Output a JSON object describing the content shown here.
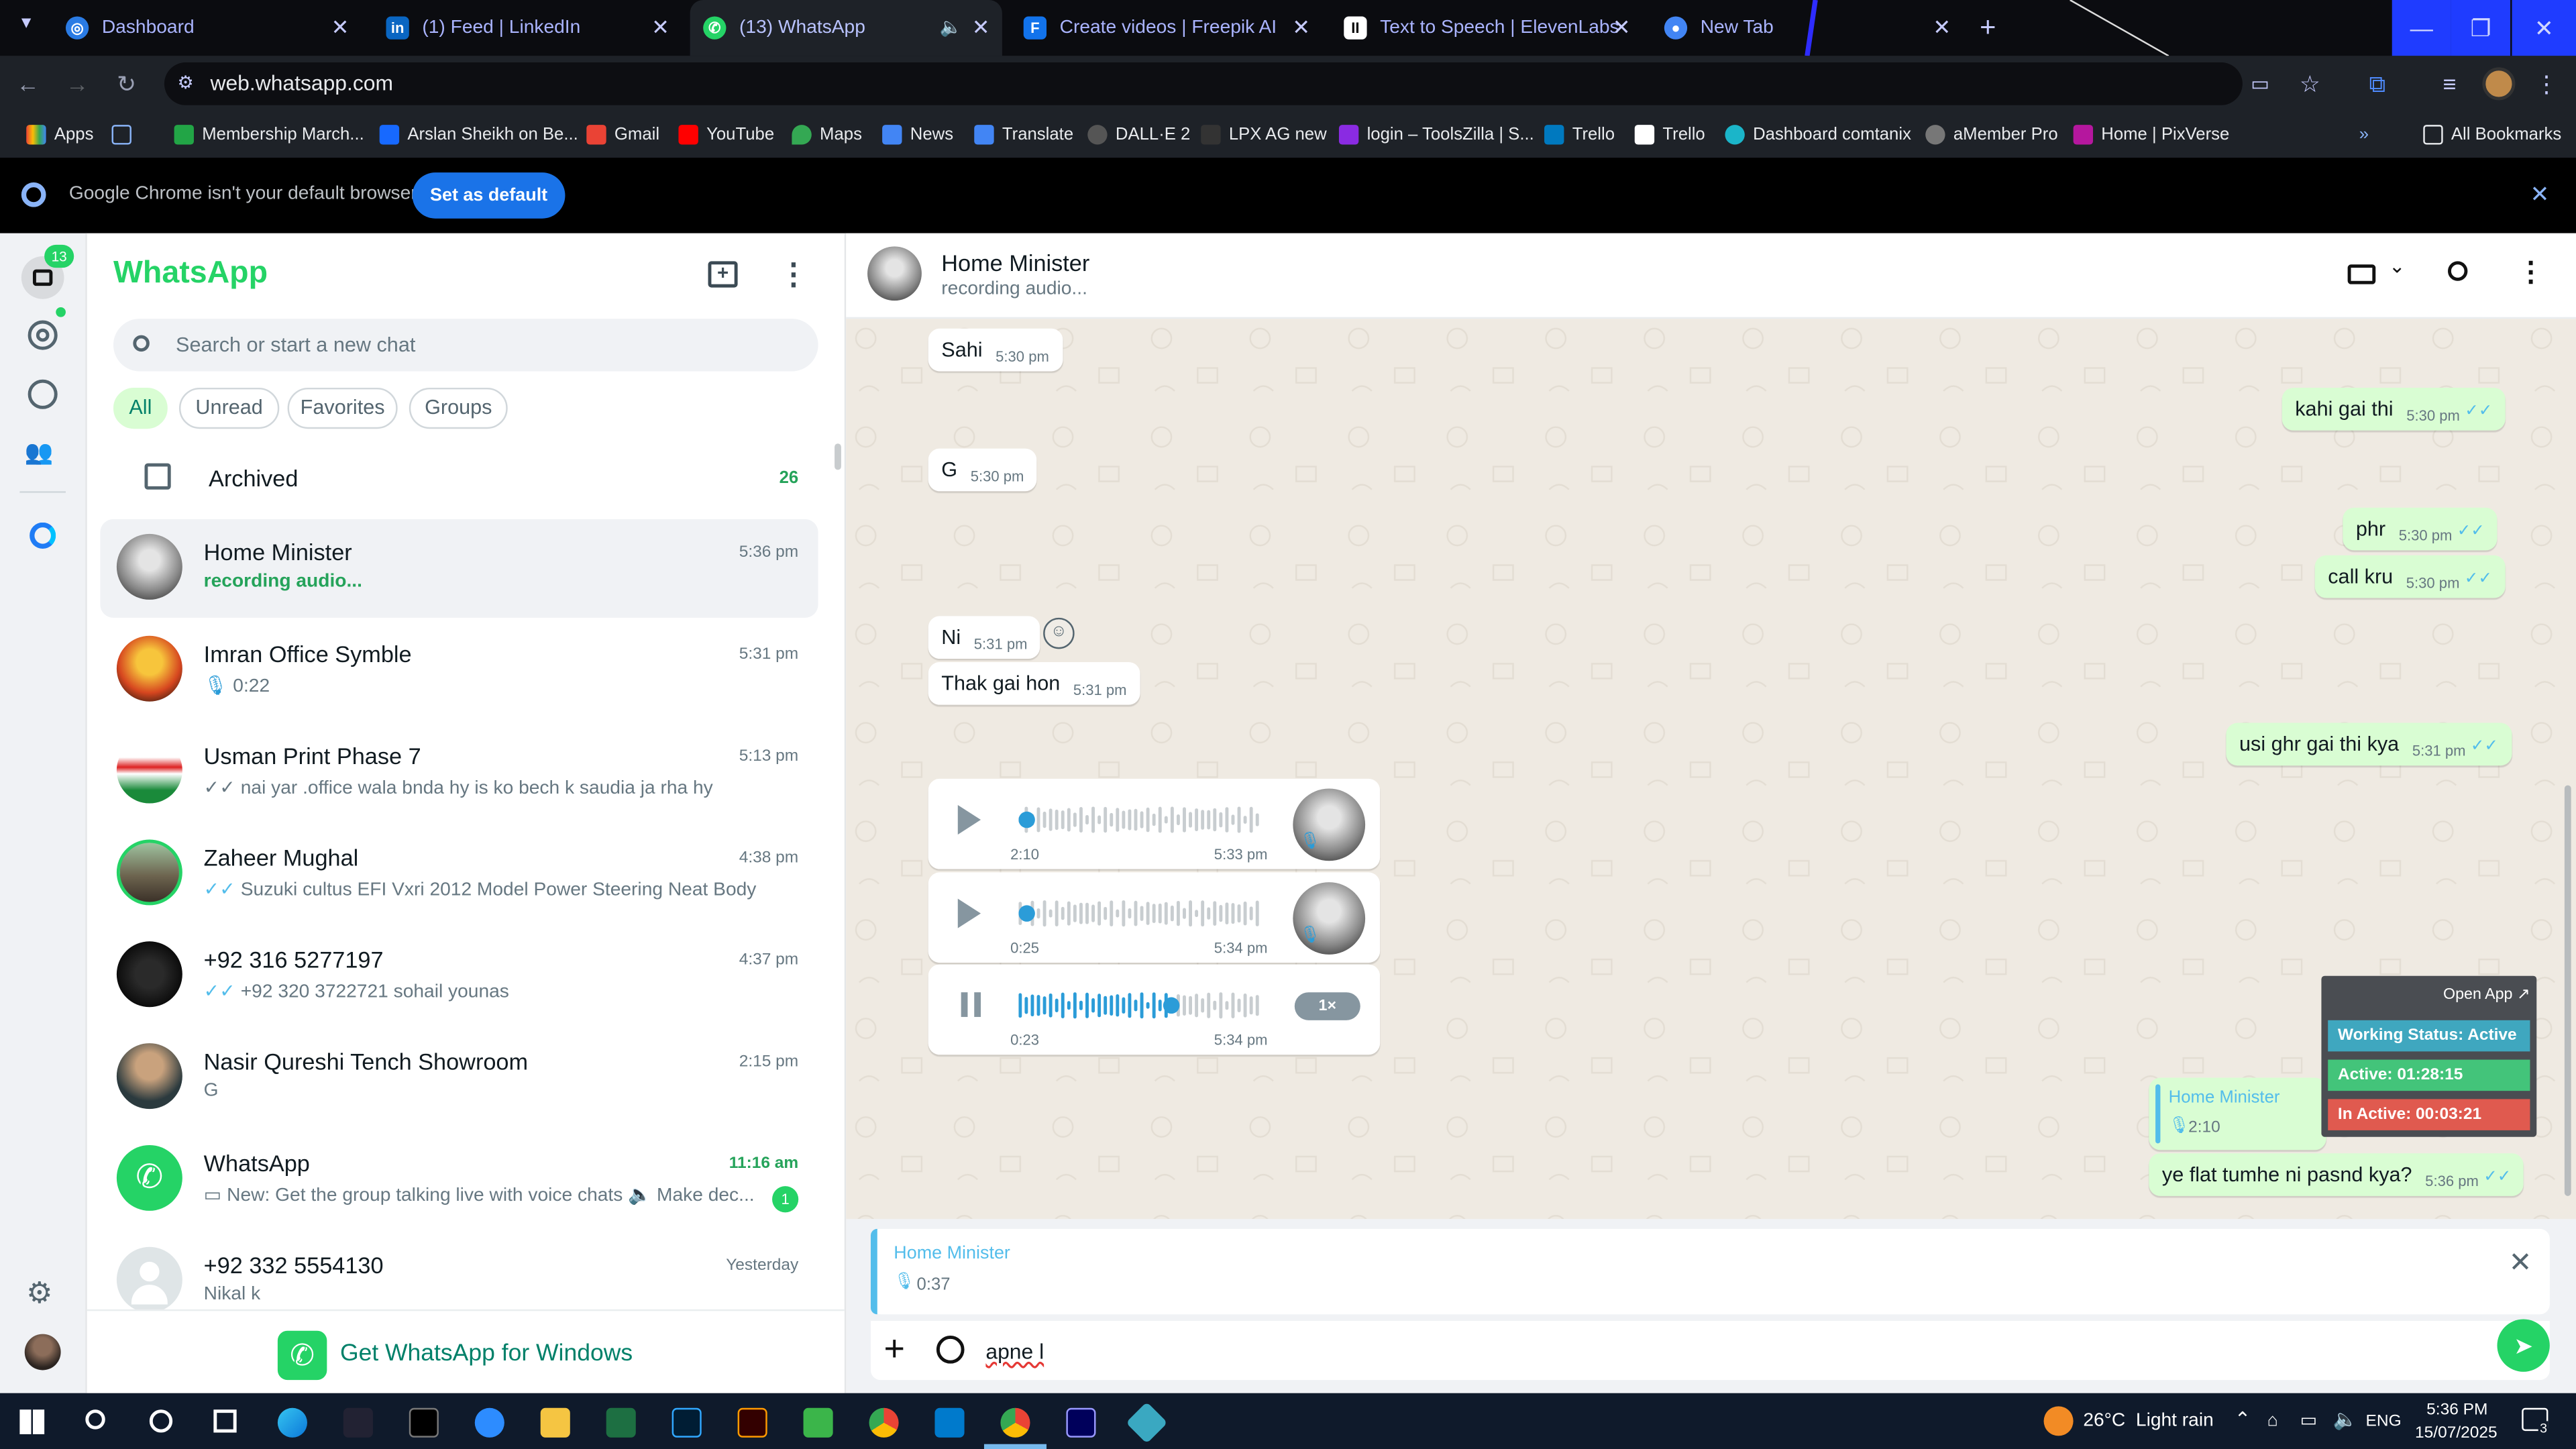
{
  "browser": {
    "tabs": [
      {
        "title": "Dashboard",
        "icon": "globe-icon",
        "color": "#2a7be4"
      },
      {
        "title": "(1) Feed | LinkedIn",
        "icon": "linkedin-icon",
        "color": "#0a66c2"
      },
      {
        "title": "(13) WhatsApp",
        "icon": "whatsapp-icon",
        "color": "#25d366"
      },
      {
        "title": "Create videos | Freepik AI",
        "icon": "freepik-icon",
        "color": "#1273eb"
      },
      {
        "title": "Text to Speech | ElevenLabs",
        "icon": "elevenlabs-icon",
        "color": "#ffffff"
      },
      {
        "title": "New Tab",
        "icon": "chrome-icon",
        "color": "#4285f4"
      }
    ],
    "url": "web.whatsapp.com",
    "bookmarks": [
      "Apps",
      "Membership March...",
      "Arslan Sheikh on Be...",
      "Gmail",
      "YouTube",
      "Maps",
      "News",
      "Translate",
      "DALL·E 2",
      "LPX AG new",
      "login – ToolsZilla | S...",
      "Trello",
      "Trello",
      "Dashboard comtanix",
      "aMember Pro",
      "Home | PixVerse"
    ],
    "all_bookmarks": "All Bookmarks",
    "infobar": {
      "text": "Google Chrome isn't your default browser",
      "button": "Set as default"
    }
  },
  "rail": {
    "chats_badge": "13"
  },
  "sidebar": {
    "title": "WhatsApp",
    "search_placeholder": "Search or start a new chat",
    "filters": [
      "All",
      "Unread",
      "Favorites",
      "Groups"
    ],
    "archived": {
      "label": "Archived",
      "count": "26"
    },
    "chats": [
      {
        "name": "Home Minister",
        "preview": "recording audio...",
        "time": "5:36 pm"
      },
      {
        "name": "Imran Office Symble",
        "preview": "0:22",
        "time": "5:31 pm"
      },
      {
        "name": "Usman Print Phase 7",
        "preview": "nai yar .office wala bnda hy  is ko bech k saudia ja rha hy",
        "time": "5:13 pm"
      },
      {
        "name": "Zaheer Mughal",
        "preview": "Suzuki cultus EFI Vxri 2012 Model Power Steering Neat Body Con...",
        "time": "4:38 pm"
      },
      {
        "name": "+92 316 5277197",
        "preview": "+92 320 3722721  sohail younas",
        "time": "4:37 pm"
      },
      {
        "name": "Nasir Qureshi Tench Showroom",
        "preview": "G",
        "time": "2:15 pm"
      },
      {
        "name": "WhatsApp",
        "preview": "New: Get the group talking live with voice chats 🔈 Make dec...",
        "time": "11:16 am",
        "unread": "1"
      },
      {
        "name": "+92 332 5554130",
        "preview": "Nikal k",
        "time": "Yesterday"
      }
    ],
    "get_app": "Get WhatsApp for Windows"
  },
  "conversation": {
    "name": "Home Minister",
    "status": "recording audio...",
    "messages": [
      {
        "dir": "in",
        "text": "Sahi",
        "time": "5:30 pm"
      },
      {
        "dir": "out",
        "text": "kahi gai thi",
        "time": "5:30 pm"
      },
      {
        "dir": "in",
        "text": "G",
        "time": "5:30 pm"
      },
      {
        "dir": "out",
        "text": "phr",
        "time": "5:30 pm"
      },
      {
        "dir": "out",
        "text": "call kru",
        "time": "5:30 pm"
      },
      {
        "dir": "in",
        "text": "Ni",
        "time": "5:31 pm"
      },
      {
        "dir": "in",
        "text": "Thak gai hon",
        "time": "5:31 pm"
      },
      {
        "dir": "out",
        "text": "usi ghr gai thi kya",
        "time": "5:31 pm"
      },
      {
        "dir": "out",
        "text": "ye flat tumhe ni pasnd kya?",
        "time": "5:36 pm"
      }
    ],
    "voice_notes": [
      {
        "duration": "2:10",
        "time": "5:33 pm",
        "progress": 0
      },
      {
        "duration": "0:25",
        "time": "5:34 pm",
        "progress": 0
      },
      {
        "duration": "0:23",
        "time": "5:34 pm",
        "progress": 0.62,
        "speed": "1×"
      }
    ],
    "quoted_in_chat": {
      "name": "Home Minister",
      "duration": "2:10"
    },
    "overlay": {
      "open_app": "Open App ↗",
      "working_status": "Working Status: Active",
      "active": "Active: 01:28:15",
      "inactive": "In Active: 00:03:21"
    },
    "reply_preview": {
      "name": "Home Minister",
      "duration": "0:37"
    },
    "composer_text": "apne l"
  },
  "taskbar": {
    "weather": "26°C  Light rain",
    "lang": "ENG",
    "time": "5:36 PM",
    "date": "15/07/2025",
    "notif_count": "3"
  },
  "colors": {
    "accent": "#25d366",
    "outgoing": "#d9fdd3",
    "teal": "#008069"
  }
}
